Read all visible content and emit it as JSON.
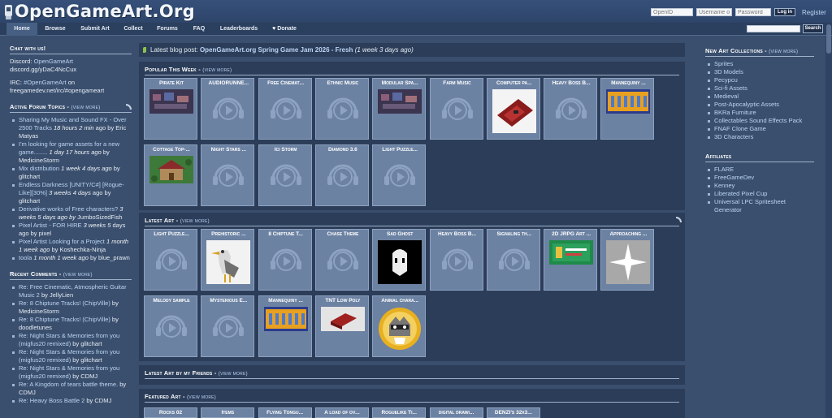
{
  "site": {
    "logo_text": "OpenGameArt.Org"
  },
  "login": {
    "openid_placeholder": "OpenID",
    "username_placeholder": "Username or",
    "password_placeholder": "Password",
    "login_label": "Log in",
    "register_label": "Register"
  },
  "nav": {
    "tabs": [
      "Home",
      "Browse",
      "Submit Art",
      "Collect",
      "Forums",
      "FAQ",
      "Leaderboards",
      "Donate"
    ],
    "search_label": "Search"
  },
  "left": {
    "chat": {
      "title": "Chat with us!",
      "discord_prefix": "Discord: ",
      "discord_link": "OpenGameArt",
      "discord_url_text": "discord.gg/yDaC4NcCux",
      "irc_prefix": "IRC: ",
      "irc_link": "#OpenGameArt",
      "irc_suffix": " on",
      "irc_url_text": "freegamedev.net/irc/#opengameart"
    },
    "forum": {
      "title": "Active Forum Topics - ",
      "more": "(view more)",
      "items": [
        {
          "lines": [
            "Sharing My Music and Sound FX -",
            "Over 2500 Tracks"
          ],
          "time": "18 hours 2 min",
          "by": "ago by Eric Matyas"
        },
        {
          "lines": [
            "I'm looking for game assets for a new",
            "game........"
          ],
          "time": "1 day 17 hours ago",
          "by": "by MedicineStorm"
        },
        {
          "lines": [
            "Mix distribution"
          ],
          "time": "1 week 4 days ago",
          "by": "by glitchart"
        },
        {
          "lines": [
            "Endless Darkness [UNITY/C#]",
            "[Rogue-Like][30%]"
          ],
          "time": "3 weeks 4 days",
          "by": "ago by glitchart"
        },
        {
          "lines": [
            "Derivative works of Free characters?"
          ],
          "time": "3 weeks 5 days ago by",
          "by": "JumboSizedFish"
        },
        {
          "lines": [
            "Pixel Artist - FOR HIRE"
          ],
          "time": "3 weeks 5",
          "by": "days ago by pixel"
        },
        {
          "lines": [
            "Pixel Artist Looking for a Project"
          ],
          "time": "1 month 1 week ago",
          "by": "by Koshechka-Ninja"
        },
        {
          "lines": [
            "toola"
          ],
          "time": "1 month 1 week ago",
          "by": "by blue_prawn"
        }
      ]
    },
    "comments": {
      "title": "Recent Comments - ",
      "more": "(view more)",
      "items": [
        {
          "lines": [
            "Re: Free Cinematic, Atmospheric",
            "Guitar Music 2"
          ],
          "by": "by JellyLien"
        },
        {
          "lines": [
            "Re: 8 Chiptune Tracks! (ChipVille)"
          ],
          "by": "by MedicineStorm"
        },
        {
          "lines": [
            "Re: 8 Chiptune Tracks! (ChipVille)"
          ],
          "by": "by doodletunes"
        },
        {
          "lines": [
            "Re: Night Stars & Memories from you",
            "(migfus20 remixed)"
          ],
          "by": "by glitchart"
        },
        {
          "lines": [
            "Re: Night Stars & Memories from you",
            "(migfus20 remixed)"
          ],
          "by": "by glitchart"
        },
        {
          "lines": [
            "Re: Night Stars & Memories from you",
            "(migfus20 remixed)"
          ],
          "by": "by CDMJ"
        },
        {
          "lines": [
            "Re: A Kingdom of tears battle theme."
          ],
          "by": "by CDMJ"
        },
        {
          "lines": [
            "Re: Heavy Boss Battle 2"
          ],
          "by": "by CDMJ"
        }
      ]
    }
  },
  "main": {
    "blog": {
      "prefix": "Latest blog post: ",
      "title": "OpenGameArt.org Spring Game Jam 2026 - Fresh",
      "time": "(1 week 3 days ago)"
    },
    "popular": {
      "title": "Popular This Week - ",
      "more": "(view more)",
      "tiles": [
        {
          "title": "Pirate Kit",
          "thumb": "screenshot"
        },
        {
          "title": "AUDIORUNNE...",
          "thumb": "audio"
        },
        {
          "title": "Free Cinemat...",
          "thumb": "audio"
        },
        {
          "title": "Ethnic Music",
          "thumb": "audio"
        },
        {
          "title": "Modular Spa...",
          "thumb": "screenshot"
        },
        {
          "title": "Farm Music",
          "thumb": "audio"
        },
        {
          "title": "Computer pa...",
          "thumb": "board"
        },
        {
          "title": "Heavy Boss B...",
          "thumb": "audio"
        },
        {
          "title": "Mannequiny ...",
          "thumb": "sprites"
        },
        {
          "title": "Cottage Top-...",
          "thumb": "cottage"
        },
        {
          "title": "Night Stars ...",
          "thumb": "audio"
        },
        {
          "title": "Ici Storm",
          "thumb": "audio"
        },
        {
          "title": "Diamond 3.6",
          "thumb": "audio"
        },
        {
          "title": "Light Puzzle...",
          "thumb": "audio"
        }
      ]
    },
    "latest": {
      "title": "Latest Art - ",
      "more": "(view more)",
      "tiles": [
        {
          "title": "Light Puzzle...",
          "thumb": "audio"
        },
        {
          "title": "Prehistoric ...",
          "thumb": "bird"
        },
        {
          "title": "8 Chiptune T...",
          "thumb": "audio"
        },
        {
          "title": "Chase Theme",
          "thumb": "audio"
        },
        {
          "title": "Sad Ghost",
          "thumb": "ghost"
        },
        {
          "title": "Heavy Boss B...",
          "thumb": "audio"
        },
        {
          "title": "Signaling th...",
          "thumb": "audio"
        },
        {
          "title": "2D JRPG Art ...",
          "thumb": "jrpg"
        },
        {
          "title": "Approaching ...",
          "thumb": "star"
        },
        {
          "title": "Melody sample",
          "thumb": "audio"
        },
        {
          "title": "Mysterious E...",
          "thumb": "audio"
        },
        {
          "title": "Mannequiny ...",
          "thumb": "sprites"
        },
        {
          "title": "TNT Low Poly",
          "thumb": "tnt"
        },
        {
          "title": "Animal chara...",
          "thumb": "raccoon"
        }
      ]
    },
    "friends": {
      "title": "Latest Art by my Friends - ",
      "more": "(view more)"
    },
    "featured": {
      "title": "Featured Art - ",
      "more": "(view more)",
      "tiles": [
        "Rocks 02",
        "Items",
        "Flying Tongu...",
        "A load of ov...",
        "Roguelike Ti...",
        "digital drawi...",
        "DENZI's 32x3..."
      ]
    }
  },
  "right": {
    "collections": {
      "title": "New Art Collections - ",
      "more": "(view more)",
      "items": [
        "Sprites",
        "3D Models",
        "Pecypcu",
        "Sci-fi Assets",
        "Medieval",
        "Post-Apocalyptic Assets",
        "BKRa Furniture",
        "Collectables Sound Effects Pack",
        "FNAF Clone Game",
        "3D Characters"
      ]
    },
    "affiliates": {
      "title": "Affiliates",
      "items": [
        "FLARE",
        "FreeGameDev",
        "Kenney",
        "Liberated Pixel Cup",
        "Universal LPC Spritesheet Generator"
      ]
    }
  },
  "colors": {
    "bg": "#3a4f6e",
    "panel": "#2b3d59",
    "tile": "#6c82a3",
    "link": "#bcd4f2"
  }
}
